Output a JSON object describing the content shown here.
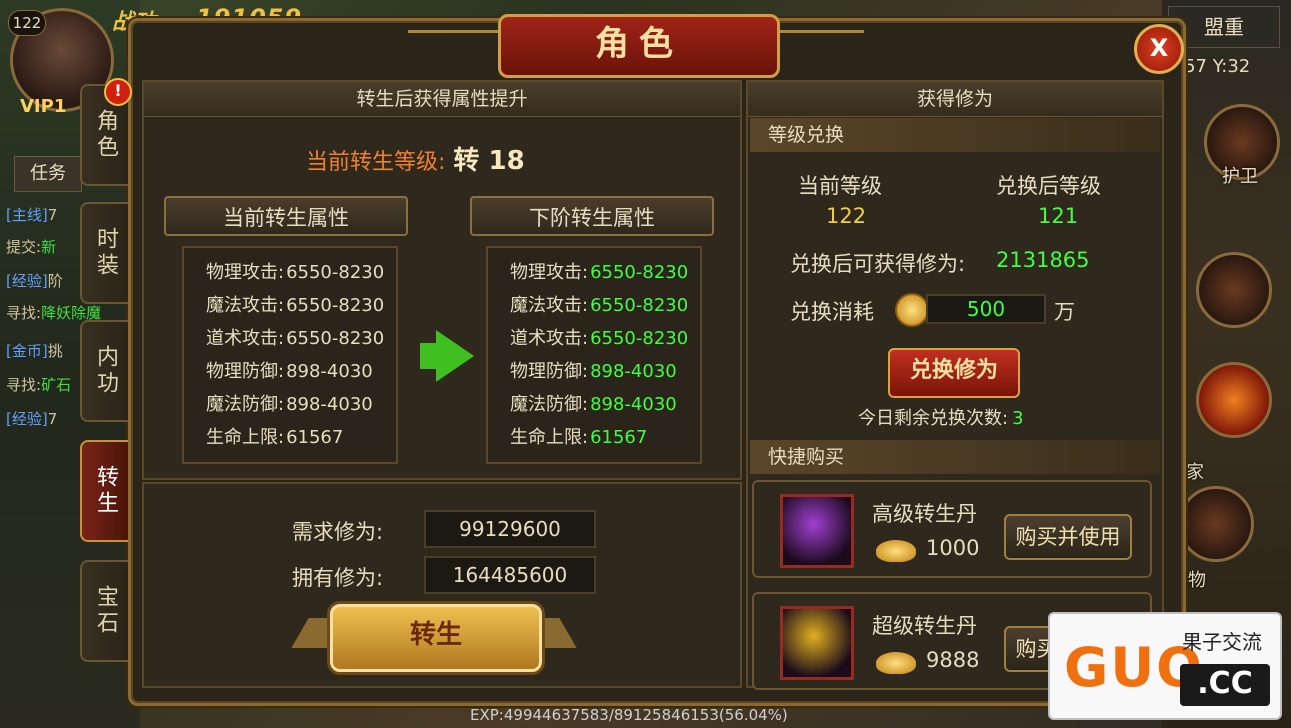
{
  "hud": {
    "level": "122",
    "power_label": "战功",
    "power_value": "191059",
    "vip": "VIP1",
    "task_tab": "任务",
    "quests": [
      {
        "tag": "[主线]",
        "text": "7",
        "color": ""
      },
      {
        "tag": "提交:",
        "text": "新",
        "color": "green"
      },
      {
        "tag": "[经验]",
        "text": "阶",
        "color": ""
      },
      {
        "tag": "寻找:",
        "text": "降妖除魔",
        "color": "green"
      },
      {
        "tag": "[金币]",
        "text": "挑",
        "color": ""
      },
      {
        "tag": "寻找:",
        "text": "矿石",
        "color": "green"
      },
      {
        "tag": "[经验]",
        "text": "7",
        "color": ""
      }
    ],
    "ally_button": "盟重",
    "coords": ":57 Y:32",
    "guard_label": "护卫",
    "player_label": "玩家",
    "monster_label": "怪物",
    "exp_text": "EXP:49944637583/89125846153(56.04%)"
  },
  "panel": {
    "title": "角色",
    "close_label": "X",
    "side_tabs": [
      "角色",
      "时装",
      "内功",
      "转生",
      "宝石"
    ],
    "active_tab_index": 3,
    "alert_badge": "!",
    "left": {
      "header": "转生后获得属性提升",
      "current_level_label": "当前转生等级:",
      "current_level_value": "转 18",
      "current_attr_header": "当前转生属性",
      "next_attr_header": "下阶转生属性",
      "current_attrs": [
        {
          "label": "物理攻击:",
          "value": "6550-8230"
        },
        {
          "label": "魔法攻击:",
          "value": "6550-8230"
        },
        {
          "label": "道术攻击:",
          "value": "6550-8230"
        },
        {
          "label": "物理防御:",
          "value": "898-4030"
        },
        {
          "label": "魔法防御:",
          "value": "898-4030"
        },
        {
          "label": "生命上限:",
          "value": "61567"
        }
      ],
      "next_attrs": [
        {
          "label": "物理攻击:",
          "value": "6550-8230"
        },
        {
          "label": "魔法攻击:",
          "value": "6550-8230"
        },
        {
          "label": "道术攻击:",
          "value": "6550-8230"
        },
        {
          "label": "物理防御:",
          "value": "898-4030"
        },
        {
          "label": "魔法防御:",
          "value": "898-4030"
        },
        {
          "label": "生命上限:",
          "value": "61567"
        }
      ],
      "required_label": "需求修为:",
      "required_value": "99129600",
      "owned_label": "拥有修为:",
      "owned_value": "164485600",
      "rebirth_button": "转生"
    },
    "right": {
      "header": "获得修为",
      "exchange_section": "等级兑换",
      "current_level_label": "当前等级",
      "current_level_value": "122",
      "after_level_label": "兑换后等级",
      "after_level_value": "121",
      "gain_label": "兑换后可获得修为:",
      "gain_value": "2131865",
      "cost_label": "兑换消耗",
      "cost_value": "500",
      "cost_unit": "万",
      "exchange_button": "兑换修为",
      "remaining_label": "今日剩余兑换次数:",
      "remaining_value": "3",
      "shop_section": "快捷购买",
      "shop_items": [
        {
          "name": "高级转生丹",
          "price": "1000",
          "button": "购买并使用",
          "color": "#a040d0"
        },
        {
          "name": "超级转生丹",
          "price": "9888",
          "button": "购买并使用",
          "color": "#e0b020"
        }
      ]
    }
  },
  "watermark": {
    "brand": "GUO",
    "domain": ".CC",
    "tagline": "果子交流"
  }
}
